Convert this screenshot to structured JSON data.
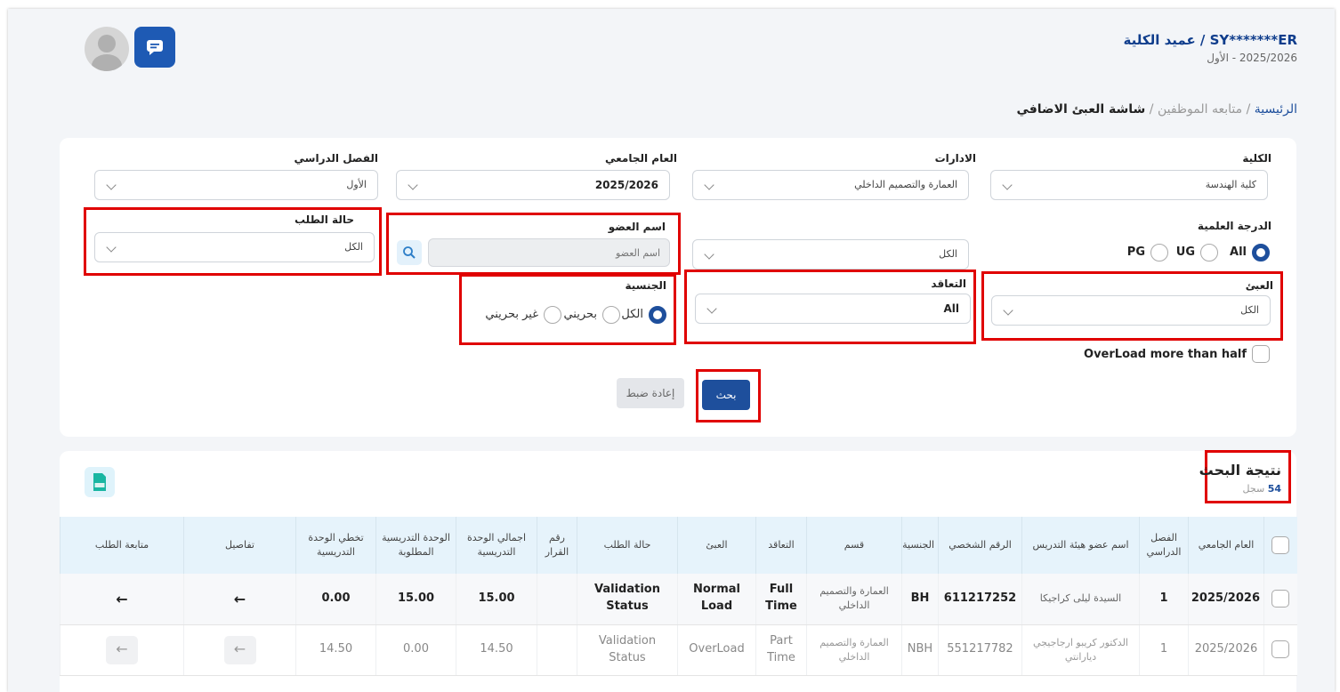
{
  "header": {
    "user_name": "SY*******ER / عميد الكلية",
    "user_term": "2025/2026 - الأول"
  },
  "breadcrumb": {
    "home": "الرئيسية",
    "sep": "/",
    "section": "متابعه الموظفين",
    "current": "شاشة العبئ الاضافي"
  },
  "filters": {
    "college": {
      "label": "الكلية",
      "value": "كلية الهندسة"
    },
    "department": {
      "label": "الادارات",
      "value": "العمارة والتصميم الداخلي"
    },
    "academic_year": {
      "label": "العام الجامعي",
      "value": "2025/2026"
    },
    "semester": {
      "label": "الفصل الدراسي",
      "value": "الأول"
    },
    "degree": {
      "label": "الدرجة العلمية",
      "options": [
        "All",
        "UG",
        "PG"
      ],
      "selected": "All"
    },
    "member_name": {
      "label": "اسم العضو",
      "placeholder": "اسم العضو"
    },
    "request_status": {
      "label": "حالة الطلب",
      "value": "الكل"
    },
    "load": {
      "label": "العبئ",
      "value": "الكل"
    },
    "contract": {
      "label": "التعاقد",
      "value": "All"
    },
    "nationality": {
      "label": "الجنسية",
      "options": [
        "الكل",
        "بحريني",
        "غير بحريني"
      ],
      "selected": "الكل"
    },
    "overload_label": "OverLoad more than half",
    "search_button": "بحث",
    "reset_button": "إعادة ضبط"
  },
  "results": {
    "title": "نتيجة البحث",
    "count": "54",
    "count_unit": "سجل",
    "export_label": "XLS",
    "columns": [
      "العام الجامعي",
      "الفصل الدراسي",
      "اسم عضو هيئة التدريس",
      "الرقم الشخصي",
      "الجنسية",
      "قسم",
      "التعاقد",
      "العبئ",
      "حالة الطلب",
      "رقم القرار",
      "اجمالي الوحدة التدريسية",
      "الوحدة التدريسية المطلوبة",
      "تخطي الوحدة التدريسية",
      "تفاصيل",
      "متابعة الطلب"
    ],
    "rows": [
      {
        "year": "2025/2026",
        "semester": "1",
        "name": "السيدة ليلى كراجيكا",
        "id": "611217252",
        "nationality": "BH",
        "department": "العمارة والتصميم الداخلي",
        "contract": "Full Time",
        "load": "Normal Load",
        "status": "Validation Status",
        "decision": "",
        "total": "15.00",
        "required": "15.00",
        "exceed": "0.00"
      },
      {
        "year": "2025/2026",
        "semester": "1",
        "name": "الدكتور كريبو ارجاجيجي ديارانتي",
        "id": "551217782",
        "nationality": "NBH",
        "department": "العمارة والتصميم الداخلي",
        "contract": "Part Time",
        "load": "OverLoad",
        "status": "Validation Status",
        "decision": "",
        "total": "14.50",
        "required": "0.00",
        "exceed": "14.50"
      }
    ]
  },
  "colors": {
    "primary": "#1e4f9c",
    "highlight": "#e00000"
  }
}
